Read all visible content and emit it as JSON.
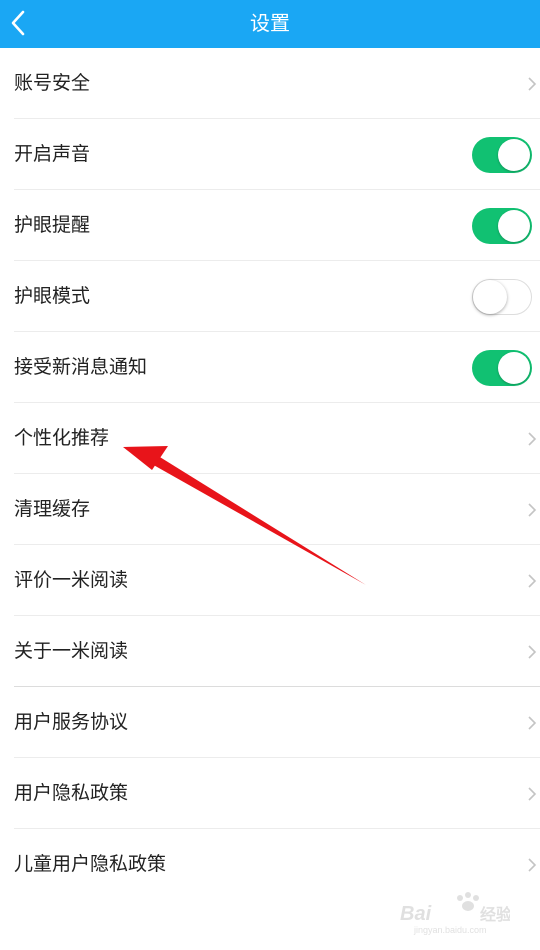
{
  "header": {
    "title": "设置",
    "back_icon": "chevron-left-icon",
    "background": "#1aa7f4"
  },
  "settings": {
    "items": [
      {
        "label": "账号安全",
        "control": "chevron"
      },
      {
        "label": "开启声音",
        "control": "toggle",
        "on": true
      },
      {
        "label": "护眼提醒",
        "control": "toggle",
        "on": true
      },
      {
        "label": "护眼模式",
        "control": "toggle",
        "on": false
      },
      {
        "label": "接受新消息通知",
        "control": "toggle",
        "on": true
      },
      {
        "label": "个性化推荐",
        "control": "chevron"
      },
      {
        "label": "清理缓存",
        "control": "chevron"
      },
      {
        "label": "评价一米阅读",
        "control": "chevron"
      },
      {
        "label": "关于一米阅读",
        "control": "chevron"
      },
      {
        "label": "用户服务协议",
        "control": "chevron"
      },
      {
        "label": "用户隐私政策",
        "control": "chevron"
      },
      {
        "label": "儿童用户隐私政策",
        "control": "chevron"
      }
    ],
    "toggle_on_color": "#11c172"
  },
  "annotation": {
    "arrow_color": "#e8141a",
    "points_to": "个性化推荐"
  },
  "watermark": {
    "brand": "Baidu 经验",
    "url": "jingyan.baidu.com"
  }
}
